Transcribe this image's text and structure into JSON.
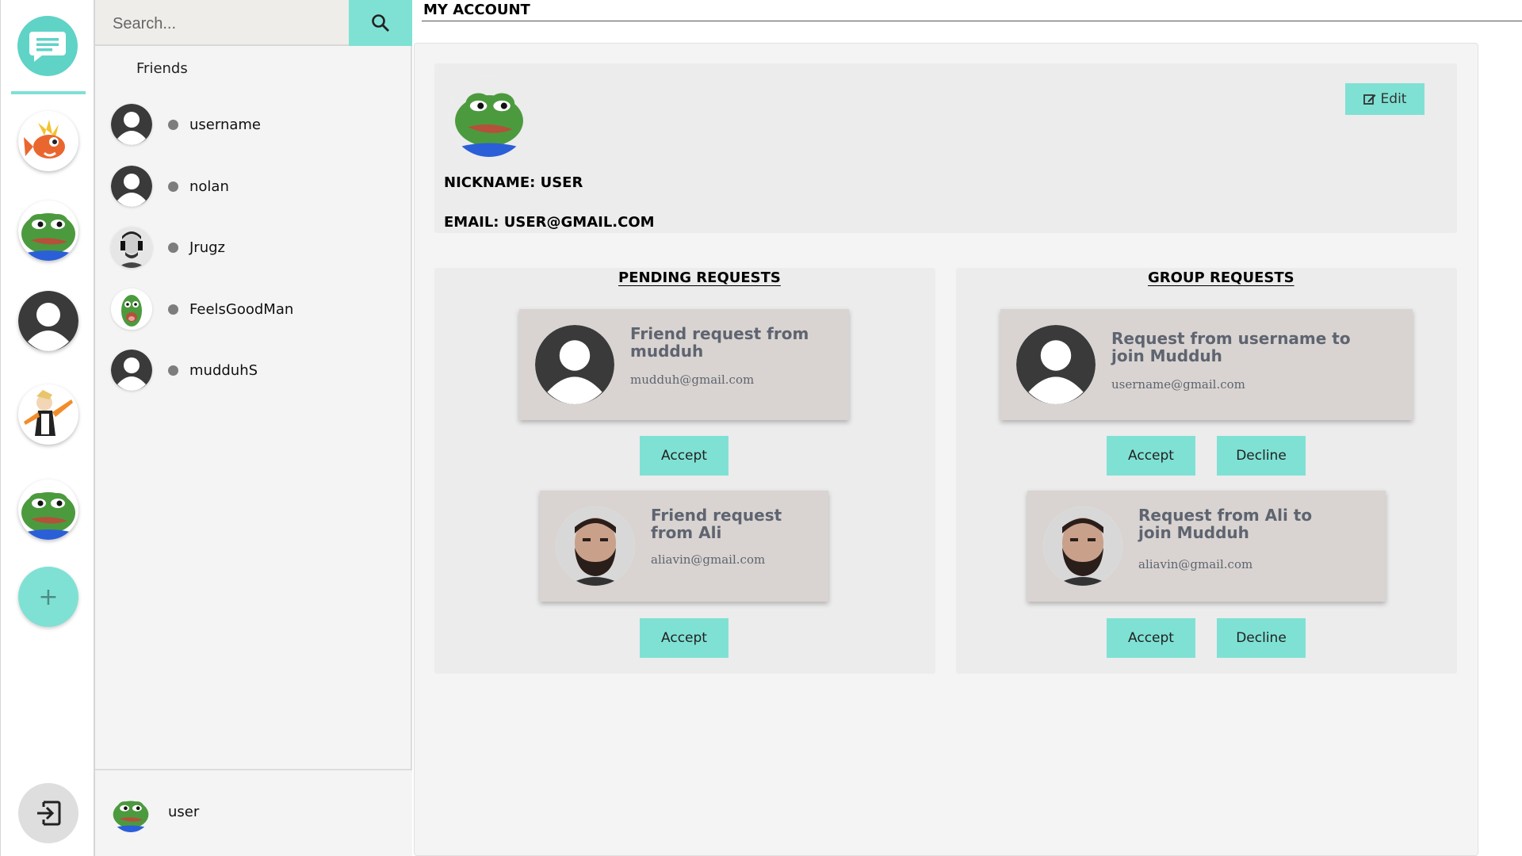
{
  "search": {
    "placeholder": "Search..."
  },
  "friends": {
    "heading": "Friends",
    "items": [
      {
        "name": "username",
        "avatar": "default-user"
      },
      {
        "name": "nolan",
        "avatar": "default-user"
      },
      {
        "name": "Jrugz",
        "avatar": "photo"
      },
      {
        "name": "FeelsGoodMan",
        "avatar": "frog"
      },
      {
        "name": "mudduhS",
        "avatar": "default-user"
      }
    ]
  },
  "current_user": {
    "name": "user"
  },
  "page": {
    "title": "MY ACCOUNT"
  },
  "profile": {
    "edit_label": "Edit",
    "nickname_line": "NICKNAME: USER",
    "email_line": "EMAIL: USER@GMAIL.COM"
  },
  "pending": {
    "heading": "PENDING REQUESTS",
    "items": [
      {
        "title": "Friend request from mudduh",
        "email": "mudduh@gmail.com",
        "accept_label": "Accept"
      },
      {
        "title": "Friend request from Ali",
        "email": "aliavin@gmail.com",
        "accept_label": "Accept"
      }
    ]
  },
  "groups": {
    "heading": "GROUP REQUESTS",
    "items": [
      {
        "title": "Request from username to join Mudduh",
        "email": "username@gmail.com",
        "accept_label": "Accept",
        "decline_label": "Decline"
      },
      {
        "title": "Request from Ali to join Mudduh",
        "email": "aliavin@gmail.com",
        "accept_label": "Accept",
        "decline_label": "Decline"
      }
    ]
  },
  "colors": {
    "accent": "#7fe1d4",
    "brand_bubble": "#5fd3c6",
    "card": "#d9d4d1",
    "status_offline": "#7d7d7d"
  },
  "icons": [
    "chat-bubble-icon",
    "search-icon",
    "edit-icon",
    "plus-icon",
    "logout-icon",
    "default-user-icon",
    "frog-avatar"
  ]
}
